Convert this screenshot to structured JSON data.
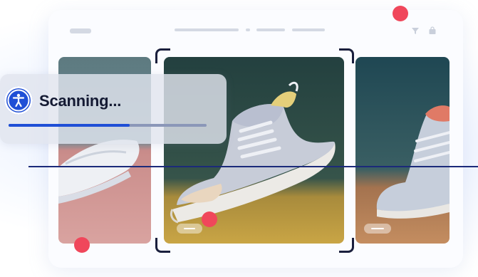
{
  "status": {
    "label": "Scanning...",
    "progress_fraction": 0.61
  },
  "icons": {
    "accessibility": "accessibility-icon",
    "filter": "filter-icon",
    "bag": "shopping-bag-icon"
  },
  "colors": {
    "accent": "#1f4fd6",
    "marker": "#f0475b",
    "scan_line": "#1b2a7a"
  }
}
